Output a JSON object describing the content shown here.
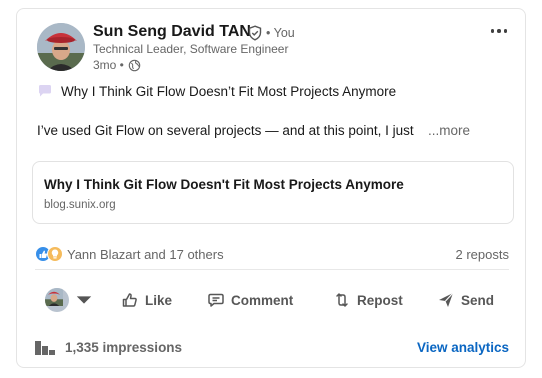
{
  "author": {
    "name": "Sun Seng David TAN",
    "relation": "• You",
    "headline": "Technical Leader, Software Engineer",
    "time": "3mo •",
    "avatar_icon": "profile-photo",
    "visibility_icon": "globe-icon",
    "verified_icon": "verified-shield-icon"
  },
  "post": {
    "title": "Why I Think Git Flow Doesn’t Fit Most Projects Anymore",
    "body": "I’ve used Git Flow on several projects — and at this point, I just",
    "see_more": "...more"
  },
  "link_preview": {
    "title": "Why I Think Git Flow Doesn't Fit Most Projects Anymore",
    "domain": "blog.sunix.org"
  },
  "social": {
    "reactions_text": "Yann Blazart and 17 others",
    "reposts_text": "2 reposts"
  },
  "actions": {
    "like": "Like",
    "comment": "Comment",
    "repost": "Repost",
    "send": "Send"
  },
  "analytics": {
    "impressions": "1,335 impressions",
    "view_link": "View analytics"
  },
  "colors": {
    "accent": "#0a66c2",
    "text_primary": "#191919",
    "text_secondary": "#666666"
  }
}
